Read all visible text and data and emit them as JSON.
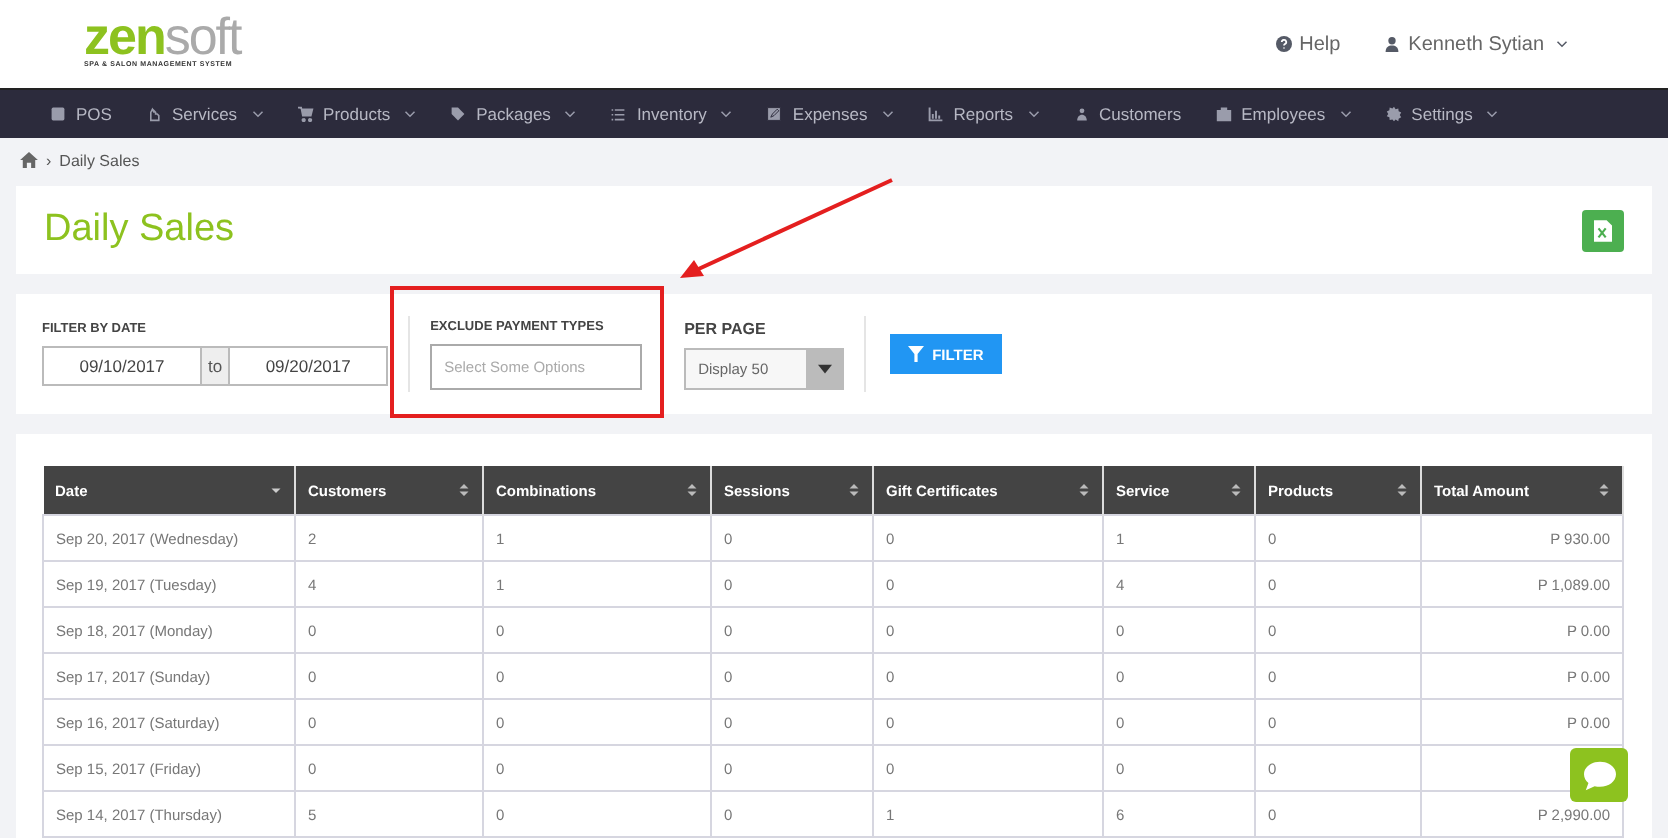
{
  "brand": {
    "name_first": "zen",
    "name_second": "soft",
    "tagline": "SPA & SALON MANAGEMENT SYSTEM"
  },
  "header": {
    "help": "Help",
    "user": "Kenneth Sytian"
  },
  "nav": [
    {
      "label": "POS",
      "has_menu": false
    },
    {
      "label": "Services",
      "has_menu": true
    },
    {
      "label": "Products",
      "has_menu": true
    },
    {
      "label": "Packages",
      "has_menu": true
    },
    {
      "label": "Inventory",
      "has_menu": true
    },
    {
      "label": "Expenses",
      "has_menu": true
    },
    {
      "label": "Reports",
      "has_menu": true
    },
    {
      "label": "Customers",
      "has_menu": false
    },
    {
      "label": "Employees",
      "has_menu": true
    },
    {
      "label": "Settings",
      "has_menu": true
    }
  ],
  "breadcrumb": {
    "separator": "›",
    "current": "Daily Sales"
  },
  "page_title": "Daily Sales",
  "filters": {
    "date_label": "FILTER BY DATE",
    "date_from": "09/10/2017",
    "date_sep": "to",
    "date_to": "09/20/2017",
    "exclude_label": "EXCLUDE PAYMENT TYPES",
    "exclude_placeholder": "Select Some Options",
    "per_page_label": "PER PAGE",
    "per_page_value": "Display 50",
    "filter_button": "FILTER"
  },
  "table": {
    "columns": [
      {
        "label": "Date",
        "sorted": true
      },
      {
        "label": "Customers",
        "sorted": false
      },
      {
        "label": "Combinations",
        "sorted": false
      },
      {
        "label": "Sessions",
        "sorted": false
      },
      {
        "label": "Gift Certificates",
        "sorted": false
      },
      {
        "label": "Service",
        "sorted": false
      },
      {
        "label": "Products",
        "sorted": false
      },
      {
        "label": "Total Amount",
        "sorted": false
      }
    ],
    "rows": [
      [
        "Sep 20, 2017 (Wednesday)",
        "2",
        "1",
        "0",
        "0",
        "1",
        "0",
        "P 930.00"
      ],
      [
        "Sep 19, 2017 (Tuesday)",
        "4",
        "1",
        "0",
        "0",
        "4",
        "0",
        "P 1,089.00"
      ],
      [
        "Sep 18, 2017 (Monday)",
        "0",
        "0",
        "0",
        "0",
        "0",
        "0",
        "P 0.00"
      ],
      [
        "Sep 17, 2017 (Sunday)",
        "0",
        "0",
        "0",
        "0",
        "0",
        "0",
        "P 0.00"
      ],
      [
        "Sep 16, 2017 (Saturday)",
        "0",
        "0",
        "0",
        "0",
        "0",
        "0",
        "P 0.00"
      ],
      [
        "Sep 15, 2017 (Friday)",
        "0",
        "0",
        "0",
        "0",
        "0",
        "0"
      ],
      [
        "Sep 14, 2017 (Thursday)",
        "5",
        "0",
        "0",
        "1",
        "6",
        "0",
        "P 2,990.00"
      ]
    ]
  }
}
